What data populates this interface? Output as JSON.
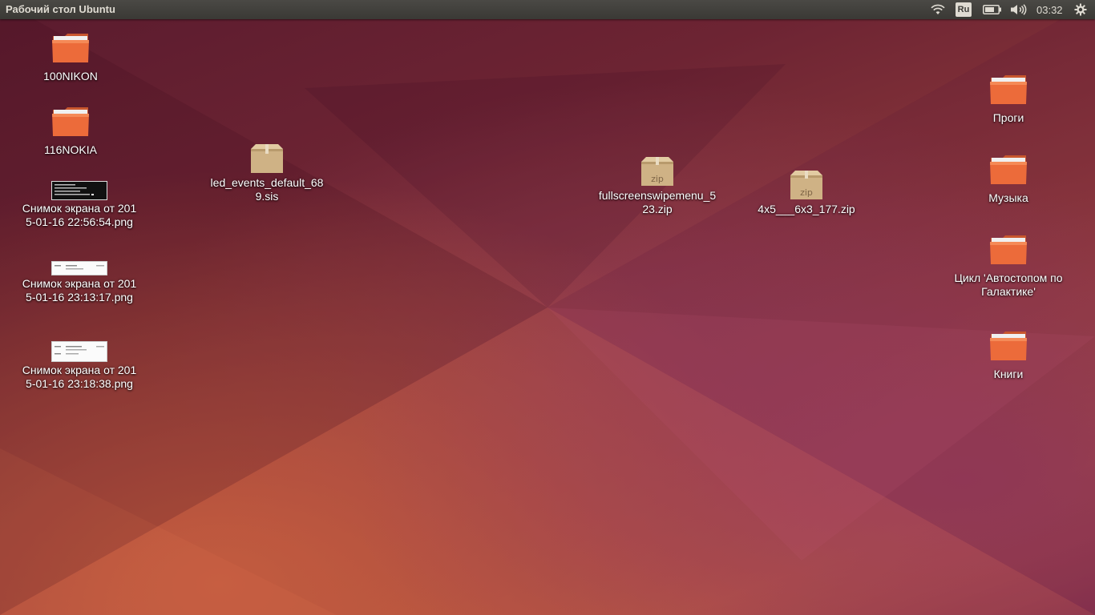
{
  "panel": {
    "title": "Рабочий стол Ubuntu",
    "language": "Ru",
    "clock": "03:32"
  },
  "colors": {
    "panel_bg": "#3c3b37",
    "folder_orange": "#e8663a",
    "archive_tan": "#c8a87a"
  },
  "desktop": {
    "left_icons": [
      {
        "label": "100NIKON",
        "icon": "folder-icon"
      },
      {
        "label": "116NOKIA",
        "icon": "folder-icon"
      },
      {
        "label": "Снимок экрана от 2015-01-16 22:56:54.png",
        "icon": "terminal-screenshot-thumbnail"
      },
      {
        "label": "Снимок экрана от 2015-01-16 23:13:17.png",
        "icon": "screenshot-thumbnail"
      },
      {
        "label": "Снимок экрана от 2015-01-16 23:18:38.png",
        "icon": "screenshot-thumbnail"
      }
    ],
    "archives": [
      {
        "label": "led_events_default_689.sis",
        "icon": "package-icon"
      },
      {
        "label": "fullscreenswipemenu_523.zip",
        "icon": "zip-archive-icon",
        "badge": "zip"
      },
      {
        "label": "4x5___6x3_177.zip",
        "icon": "zip-archive-icon",
        "badge": "zip"
      }
    ],
    "right_icons": [
      {
        "label": "Проги",
        "icon": "folder-icon"
      },
      {
        "label": "Музыка",
        "icon": "folder-icon"
      },
      {
        "label": "Цикл 'Автостопом по Галактике'",
        "icon": "folder-icon"
      },
      {
        "label": "Книги",
        "icon": "folder-icon"
      }
    ]
  }
}
